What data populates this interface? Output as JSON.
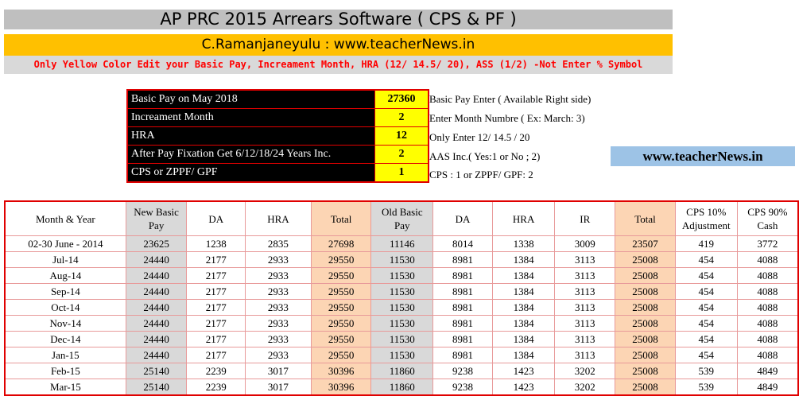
{
  "header": {
    "title": "AP PRC 2015 Arrears Software ( CPS & PF )",
    "author": "C.Ramanjaneyulu : www.teacherNews.in",
    "note": "Only Yellow Color Edit your Basic Pay, Increament Month, HRA (12/ 14.5/ 20), ASS (1/2) -Not Enter % Symbol"
  },
  "inputs": [
    {
      "label": "Basic Pay on May 2018",
      "value": "27360",
      "hint": "Basic Pay Enter  ( Available Right side)"
    },
    {
      "label": "Increament Month",
      "value": "2",
      "hint": "Enter Month Numbre ( Ex: March: 3)"
    },
    {
      "label": "HRA",
      "value": "12",
      "hint": "Only Enter 12/ 14.5 / 20"
    },
    {
      "label": "After Pay Fixation Get 6/12/18/24 Years Inc.",
      "value": "2",
      "hint": "AAS Inc.( Yes:1 or No ; 2)"
    },
    {
      "label": "CPS or ZPPF/ GPF",
      "value": "1",
      "hint": "CPS : 1 or ZPPF/ GPF: 2"
    }
  ],
  "site_badge": "www.teacherNews.in",
  "table": {
    "columns": [
      "Month & Year",
      "New Basic Pay",
      "DA",
      "HRA",
      "Total",
      "Old Basic Pay",
      "DA",
      "HRA",
      "IR",
      "Total",
      "CPS 10% Adjustment",
      "CPS 90% Cash"
    ],
    "rows": [
      [
        "02-30 June - 2014",
        "23625",
        "1238",
        "2835",
        "27698",
        "11146",
        "8014",
        "1338",
        "3009",
        "23507",
        "419",
        "3772"
      ],
      [
        "Jul-14",
        "24440",
        "2177",
        "2933",
        "29550",
        "11530",
        "8981",
        "1384",
        "3113",
        "25008",
        "454",
        "4088"
      ],
      [
        "Aug-14",
        "24440",
        "2177",
        "2933",
        "29550",
        "11530",
        "8981",
        "1384",
        "3113",
        "25008",
        "454",
        "4088"
      ],
      [
        "Sep-14",
        "24440",
        "2177",
        "2933",
        "29550",
        "11530",
        "8981",
        "1384",
        "3113",
        "25008",
        "454",
        "4088"
      ],
      [
        "Oct-14",
        "24440",
        "2177",
        "2933",
        "29550",
        "11530",
        "8981",
        "1384",
        "3113",
        "25008",
        "454",
        "4088"
      ],
      [
        "Nov-14",
        "24440",
        "2177",
        "2933",
        "29550",
        "11530",
        "8981",
        "1384",
        "3113",
        "25008",
        "454",
        "4088"
      ],
      [
        "Dec-14",
        "24440",
        "2177",
        "2933",
        "29550",
        "11530",
        "8981",
        "1384",
        "3113",
        "25008",
        "454",
        "4088"
      ],
      [
        "Jan-15",
        "24440",
        "2177",
        "2933",
        "29550",
        "11530",
        "8981",
        "1384",
        "3113",
        "25008",
        "454",
        "4088"
      ],
      [
        "Feb-15",
        "25140",
        "2239",
        "3017",
        "30396",
        "11860",
        "9238",
        "1423",
        "3202",
        "25008",
        "539",
        "4849"
      ],
      [
        "Mar-15",
        "25140",
        "2239",
        "3017",
        "30396",
        "11860",
        "9238",
        "1423",
        "3202",
        "25008",
        "539",
        "4849"
      ]
    ]
  }
}
